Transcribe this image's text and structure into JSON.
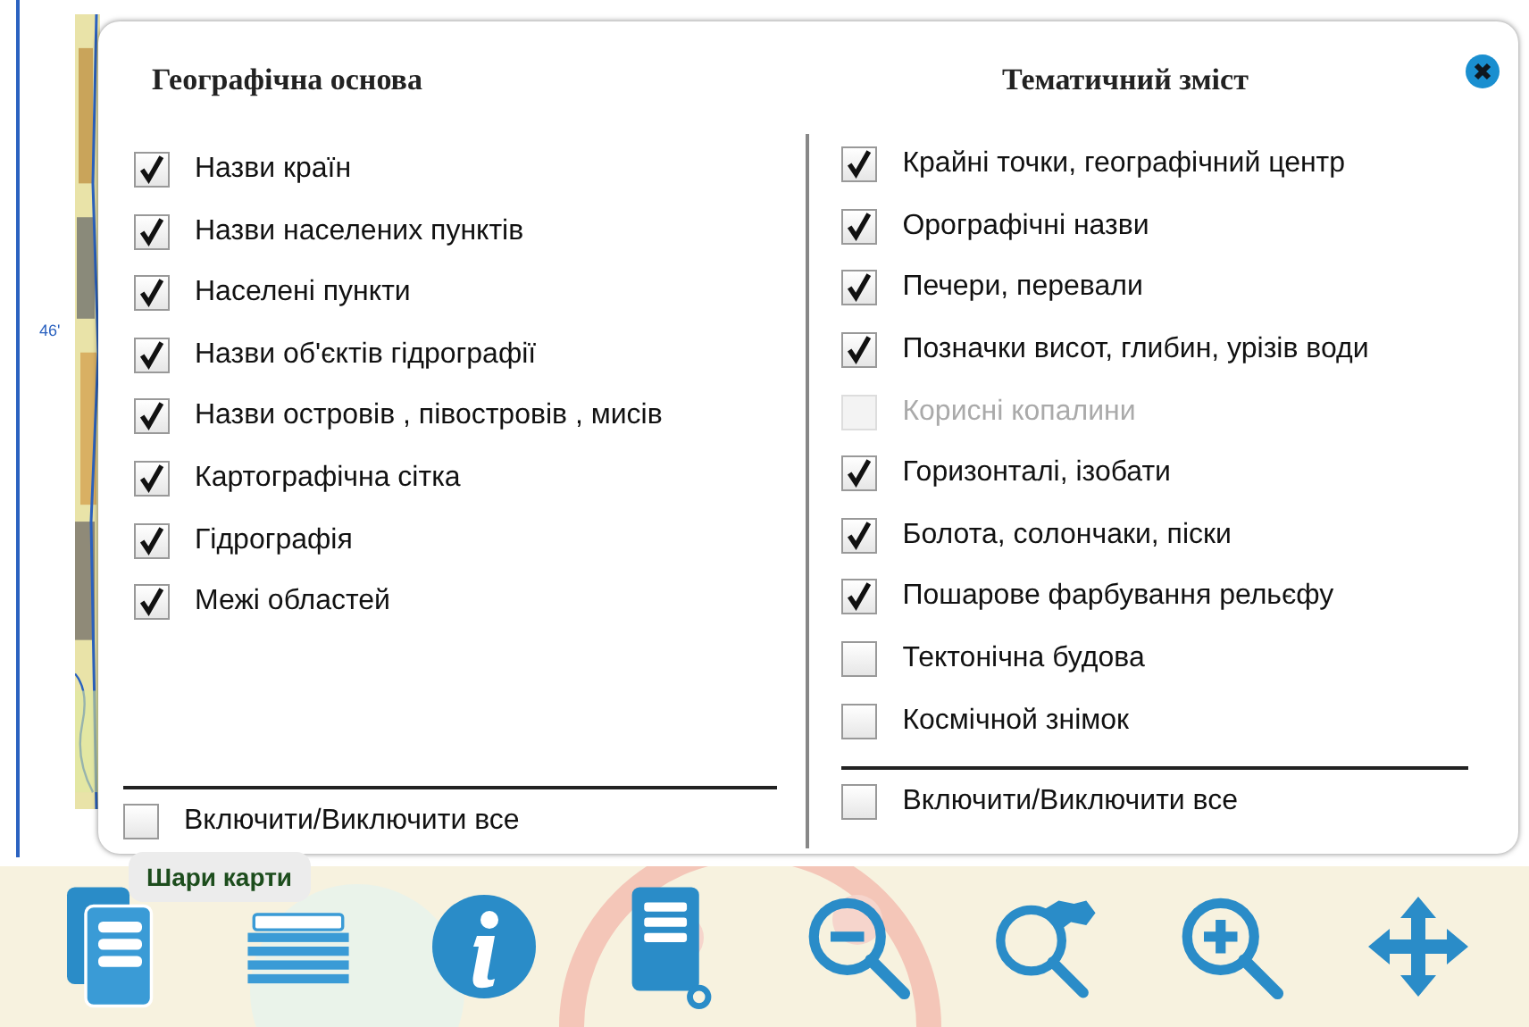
{
  "map": {
    "grid_label": "46'"
  },
  "panel": {
    "columns": [
      {
        "title": "Географічна основа",
        "items": [
          {
            "label": "Назви країн",
            "checked": true,
            "disabled": false
          },
          {
            "label": "Назви населених пунктів",
            "checked": true,
            "disabled": false
          },
          {
            "label": "Населені пункти",
            "checked": true,
            "disabled": false
          },
          {
            "label": "Назви об'єктів  гідрографії",
            "checked": true,
            "disabled": false
          },
          {
            "label": "Назви островів , півостровів , мисів",
            "checked": true,
            "disabled": false
          },
          {
            "label": "Картографічна сітка",
            "checked": true,
            "disabled": false
          },
          {
            "label": "Гідрографія",
            "checked": true,
            "disabled": false
          },
          {
            "label": "Межі областей",
            "checked": true,
            "disabled": false
          }
        ],
        "toggle_all": {
          "label": "Включити/Виключити все",
          "checked": false
        }
      },
      {
        "title": "Тематичний зміст",
        "items": [
          {
            "label": "Крайні точки, географічний центр",
            "checked": true,
            "disabled": false
          },
          {
            "label": "Орографічні назви",
            "checked": true,
            "disabled": false
          },
          {
            "label": "Печери, перевали",
            "checked": true,
            "disabled": false
          },
          {
            "label": "Позначки висот, глибин, урізів  води",
            "checked": true,
            "disabled": false
          },
          {
            "label": "Корисні копалини",
            "checked": false,
            "disabled": true
          },
          {
            "label": "Горизонталі, ізобати",
            "checked": true,
            "disabled": false
          },
          {
            "label": "Болота, солончаки, піски",
            "checked": true,
            "disabled": false
          },
          {
            "label": "Пошарове фарбування рельєфу",
            "checked": true,
            "disabled": false
          },
          {
            "label": "Тектонічна будова",
            "checked": false,
            "disabled": false
          },
          {
            "label": "Космічной знімок",
            "checked": false,
            "disabled": false
          }
        ],
        "toggle_all": {
          "label": "Включити/Виключити все",
          "checked": false
        }
      }
    ]
  },
  "toolbar": {
    "tooltip": "Шари карти",
    "buttons": [
      {
        "kind": "pages"
      },
      {
        "kind": "layers"
      },
      {
        "kind": "info"
      },
      {
        "kind": "document"
      },
      {
        "kind": "zoomout"
      },
      {
        "kind": "zoomextent"
      },
      {
        "kind": "zoomin"
      },
      {
        "kind": "pan"
      }
    ]
  }
}
